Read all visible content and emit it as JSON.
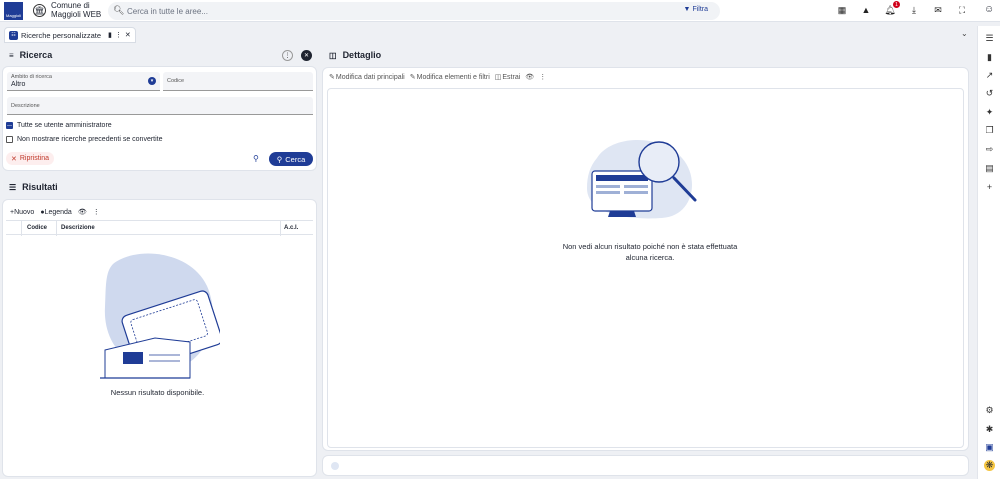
{
  "topbar": {
    "logo_text": "Maggioli",
    "org_name": "Comune di Maggioli WEB",
    "search_placeholder": "Cerca in tutte le aree...",
    "filter_label": "Filtra",
    "notification_count": "1",
    "icons": [
      "apps-icon",
      "warning-icon",
      "bell-icon",
      "download-icon",
      "mail-icon",
      "fullscreen-icon",
      "account-icon"
    ]
  },
  "tabs": [
    {
      "label": "Ricerche personalizzate",
      "icons": [
        "bookmark-icon",
        "more-icon",
        "close-icon"
      ]
    }
  ],
  "ricerca": {
    "title": "Ricerca",
    "ambito_label": "Ambito di ricerca",
    "ambito_value": "Altro",
    "codice_label": "Codice",
    "descrizione_label": "Descrizione",
    "check_admin": "Tutte se utente amministratore",
    "check_admin_on": true,
    "check_converted": "Non mostrare ricerche precedenti se convertite",
    "check_converted_on": false,
    "reset_label": "Ripristina",
    "search_label": "Cerca"
  },
  "risultati": {
    "title": "Risultati",
    "new_label": "Nuovo",
    "legend_label": "Legenda",
    "columns": [
      "Codice",
      "Descrizione",
      "A.c.l."
    ],
    "empty_message": "Nessun risultato disponibile."
  },
  "dettaglio": {
    "title": "Dettaglio",
    "toolbar": [
      "Modifica dati principali",
      "Modifica elementi e filtri",
      "Estrai"
    ],
    "empty_message_line1": "Non vedi alcun risultato poiché non è stata effettuata",
    "empty_message_line2": "alcuna ricerca."
  },
  "right_rail": {
    "icons": [
      "list-icon",
      "book-icon",
      "chart-icon",
      "history-icon",
      "tools-icon",
      "copy-icon",
      "export-icon",
      "document-icon",
      "plus-icon",
      "settings-icon",
      "accessibility-icon",
      "chat-icon",
      "help-icon"
    ]
  },
  "colors": {
    "primary": "#1f3c96",
    "reset": "#c0392b",
    "illustration_bg": "#cfd9ee"
  }
}
